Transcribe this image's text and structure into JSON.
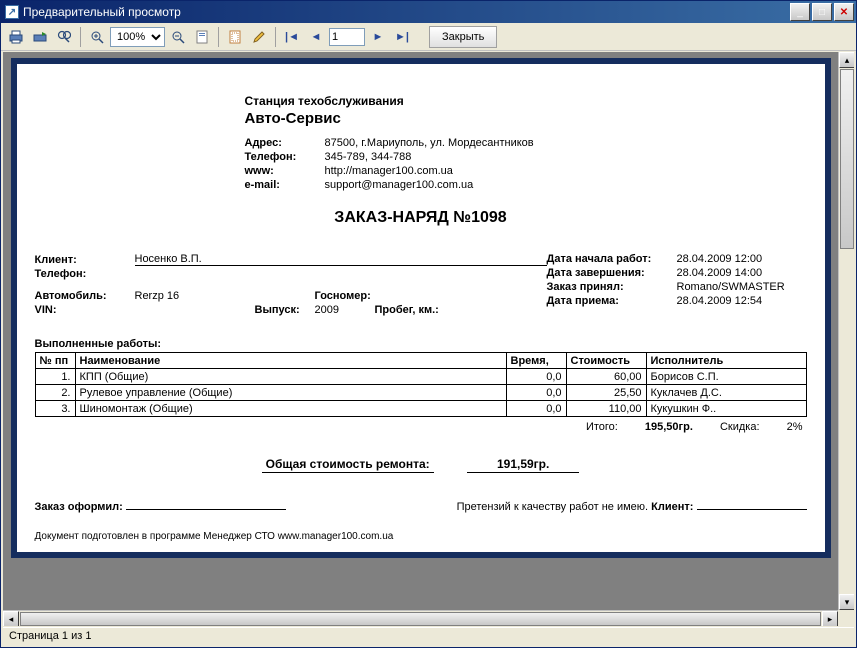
{
  "window": {
    "title": "Предварительный просмотр"
  },
  "toolbar": {
    "zoom": "100%",
    "page": "1",
    "close": "Закрыть"
  },
  "statusbar": {
    "text": "Страница 1 из 1"
  },
  "station": {
    "subtitle": "Станция техобслуживания",
    "name": "Авто-Сервис",
    "addressLabel": "Адрес:",
    "address": "87500, г.Мариуполь, ул. Мордесантников",
    "phoneLabel": "Телефон:",
    "phone": "345-789, 344-788",
    "wwwLabel": "www:",
    "www": "http://manager100.com.ua",
    "emailLabel": "e-mail:",
    "email": "support@manager100.com.ua"
  },
  "docTitle": "ЗАКАЗ-НАРЯД №1098",
  "client": {
    "clientLabel": "Клиент:",
    "clientName": "Носенко В.П.",
    "phoneLabel": "Телефон:",
    "phone": "",
    "carLabel": "Автомобиль:",
    "car": "Rerzp 16",
    "plateLabel": "Госномер:",
    "plate": "",
    "vinLabel": "VIN:",
    "vin": "",
    "yearLabel": "Выпуск:",
    "year": "2009",
    "mileageLabel": "Пробег, км.:",
    "mileage": ""
  },
  "meta": {
    "startLabel": "Дата начала работ:",
    "start": "28.04.2009 12:00",
    "endLabel": "Дата завершения:",
    "end": "28.04.2009 14:00",
    "acceptedLabel": "Заказ принял:",
    "accepted": "Romano/SWMASTER",
    "receivedLabel": "Дата приема:",
    "received": "28.04.2009 12:54"
  },
  "works": {
    "title": "Выполненные работы:",
    "headers": {
      "num": "№ пп",
      "name": "Наименование",
      "time": "Время,",
      "cost": "Стоимость",
      "exec": "Исполнитель"
    },
    "rows": [
      {
        "n": "1.",
        "name": "КПП (Общие)",
        "time": "0,0",
        "cost": "60,00",
        "exec": "Борисов С.П."
      },
      {
        "n": "2.",
        "name": "Рулевое управление (Общие)",
        "time": "0,0",
        "cost": "25,50",
        "exec": "Куклачев Д.С."
      },
      {
        "n": "3.",
        "name": "Шиномонтаж (Общие)",
        "time": "0,0",
        "cost": "110,00",
        "exec": "Кукушкин Ф.."
      }
    ],
    "totalLabel": "Итого:",
    "total": "195,50гр.",
    "discountLabel": "Скидка:",
    "discount": "2%"
  },
  "grand": {
    "label": "Общая стоимость ремонта:",
    "value": "191,59гр."
  },
  "sign": {
    "issuedLabel": "Заказ оформил:",
    "claimText": "Претензий к качеству работ не имею.",
    "clientLabel": "Клиент:"
  },
  "footer": {
    "text": "Документ подготовлен в программе Менеджер СТО ",
    "link": "www.manager100.com.ua"
  }
}
